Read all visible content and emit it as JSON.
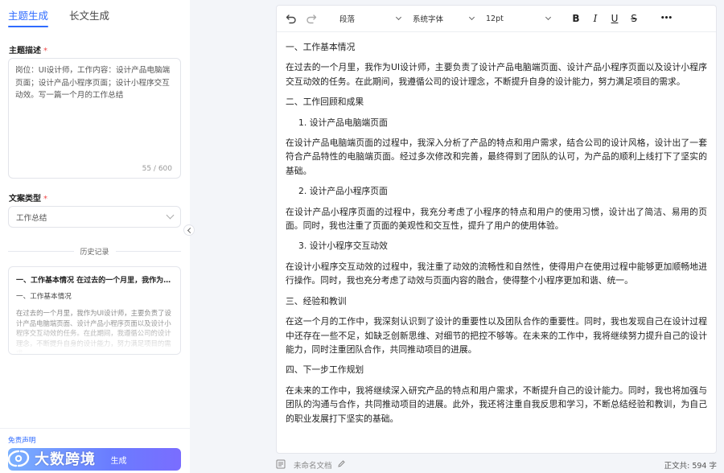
{
  "left": {
    "tabs": [
      "主题生成",
      "长文生成"
    ],
    "topic_label": "主题描述",
    "required_mark": "*",
    "topic_text": "岗位：UI设计师，工作内容：设计产品电脑端页面；设计产品小程序页面；设计小程序交互动效。写一篇一个月的工作总结",
    "topic_counter": "55 / 600",
    "type_label": "文案类型",
    "type_value": "工作总结",
    "history_label": "历史记录",
    "history": {
      "title": "一、工作基本情况 在过去的一个月里，我作为UI设...",
      "subtitle": "一、工作基本情况",
      "body": "在过去的一个月里，我作为UI设计师，主要负责了设计产品电脑端页面、设计产品小程序页面以及设计小程序交互动效的任务。在此期间，我遵循公司的设计理念，不断提升自身的设计能力，努力满足项目的需求。"
    },
    "disclaimer": "免责声明",
    "generate_label": "生成",
    "watermark_text": "大数跨境"
  },
  "toolbar": {
    "paragraph": "段落",
    "font": "系统字体",
    "size": "12pt",
    "bold": "B",
    "italic": "I",
    "underline": "U",
    "strike": "S",
    "more": "•••"
  },
  "doc": {
    "h1": "一、工作基本情况",
    "p1": "在过去的一个月里，我作为UI设计师，主要负责了设计产品电脑端页面、设计产品小程序页面以及设计小程序交互动效的任务。在此期间，我遵循公司的设计理念，不断提升自身的设计能力，努力满足项目的需求。",
    "h2": "二、工作回顾和成果",
    "s1": "1. 设计产品电脑端页面",
    "p2": "在设计产品电脑端页面的过程中，我深入分析了产品的特点和用户需求，结合公司的设计风格，设计出了一套符合产品特性的电脑端页面。经过多次修改和完善，最终得到了团队的认可，为产品的顺利上线打下了坚实的基础。",
    "s2": "2. 设计产品小程序页面",
    "p3": "在设计产品小程序页面的过程中，我充分考虑了小程序的特点和用户的使用习惯，设计出了简洁、易用的页面。同时，我也注重了页面的美观性和交互性，提升了用户的使用体验。",
    "s3": "3. 设计小程序交互动效",
    "p4": "在设计小程序交互动效的过程中，我注重了动效的流畅性和自然性，使得用户在使用过程中能够更加顺畅地进行操作。同时，我也充分考虑了动效与页面内容的融合，使得整个小程序更加和谐、统一。",
    "h3": "三、经验和教训",
    "p5": "在这一个月的工作中，我深刻认识到了设计的重要性以及团队合作的重要性。同时，我也发现自己在设计过程中还存在一些不足，如缺乏创新思维、对细节的把控不够等。在未来的工作中，我将继续努力提升自己的设计能力，同时注重团队合作，共同推动项目的进展。",
    "h4": "四、下一步工作规划",
    "p6": "在未来的工作中，我将继续深入研究产品的特点和用户需求，不断提升自己的设计能力。同时，我也将加强与团队的沟通与合作，共同推动项目的进展。此外，我还将注重自我反思和学习，不断总结经验和教训，为自己的职业发展打下坚实的基础。"
  },
  "status": {
    "doc_name": "未命名文档",
    "word_count": "正文共: 594 字"
  },
  "colors": {
    "accent": "#2f6bff",
    "required": "#f04a4a"
  }
}
